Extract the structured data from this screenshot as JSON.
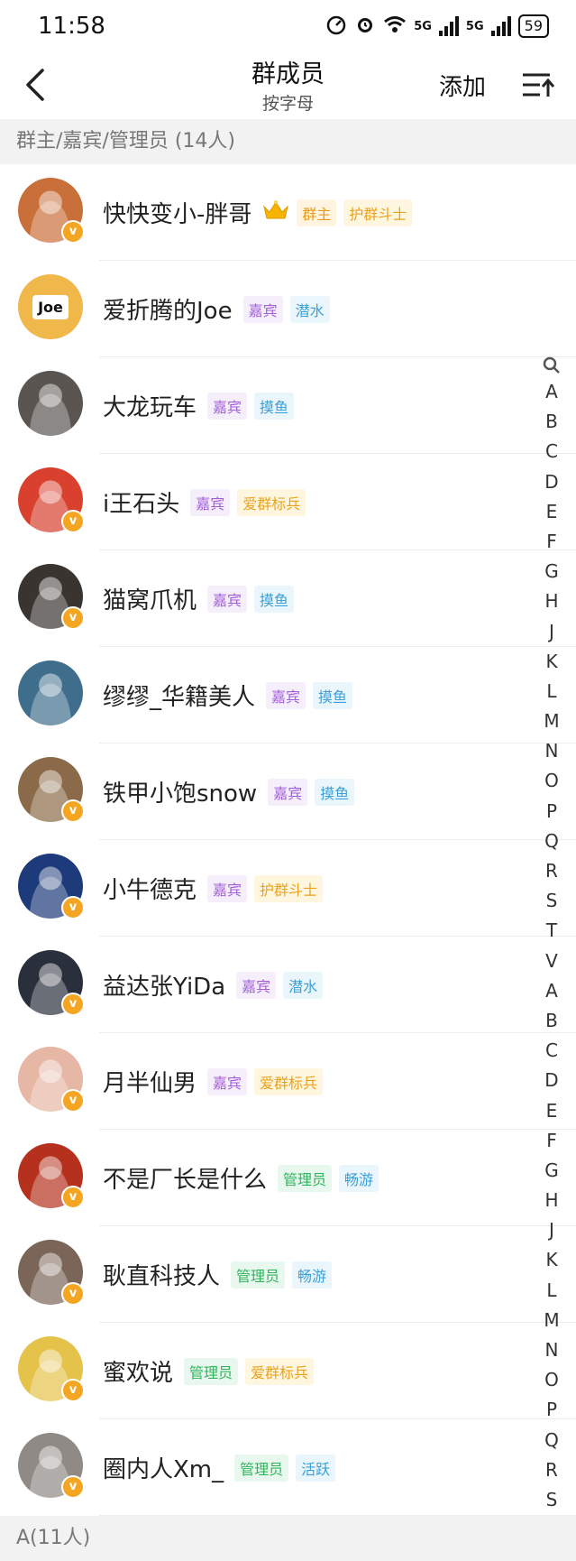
{
  "status_bar": {
    "time": "11:58",
    "battery": "59",
    "net1": "5G",
    "net2": "5G"
  },
  "header": {
    "title": "群成员",
    "subtitle": "按字母",
    "add_label": "添加"
  },
  "sections": {
    "managers": "群主/嘉宾/管理员 (14人)",
    "a_section": "A(11人)"
  },
  "members": [
    {
      "name": "快快变小-胖哥",
      "crown": true,
      "verified": true,
      "avatar_color": "#c96f3a",
      "avatar_text": "",
      "tags": [
        {
          "label": "群主",
          "type": "owner"
        },
        {
          "label": "护群斗士",
          "type": "fighter"
        }
      ]
    },
    {
      "name": "爱折腾的Joe",
      "verified": false,
      "avatar_color": "#f0b74a",
      "avatar_text": "Joe",
      "tags": [
        {
          "label": "嘉宾",
          "type": "guest"
        },
        {
          "label": "潜水",
          "type": "dive"
        }
      ]
    },
    {
      "name": "大龙玩车",
      "verified": false,
      "avatar_color": "#5a5550",
      "avatar_text": "",
      "tags": [
        {
          "label": "嘉宾",
          "type": "guest"
        },
        {
          "label": "摸鱼",
          "type": "fish"
        }
      ]
    },
    {
      "name": "i王石头",
      "verified": true,
      "avatar_color": "#d9402e",
      "avatar_text": "",
      "tags": [
        {
          "label": "嘉宾",
          "type": "guest"
        },
        {
          "label": "爱群标兵",
          "type": "soldier"
        }
      ]
    },
    {
      "name": "猫窝爪机",
      "verified": true,
      "avatar_color": "#3a3430",
      "avatar_text": "",
      "tags": [
        {
          "label": "嘉宾",
          "type": "guest"
        },
        {
          "label": "摸鱼",
          "type": "fish"
        }
      ]
    },
    {
      "name": "缪缪_华籍美人",
      "verified": false,
      "avatar_color": "#3f6e8c",
      "avatar_text": "",
      "tags": [
        {
          "label": "嘉宾",
          "type": "guest"
        },
        {
          "label": "摸鱼",
          "type": "fish"
        }
      ]
    },
    {
      "name": "铁甲小饱snow",
      "verified": true,
      "avatar_color": "#8a6a48",
      "avatar_text": "",
      "tags": [
        {
          "label": "嘉宾",
          "type": "guest"
        },
        {
          "label": "摸鱼",
          "type": "fish"
        }
      ]
    },
    {
      "name": "小牛德克",
      "verified": true,
      "avatar_color": "#1d3a7a",
      "avatar_text": "",
      "tags": [
        {
          "label": "嘉宾",
          "type": "guest"
        },
        {
          "label": "护群斗士",
          "type": "fighter"
        }
      ]
    },
    {
      "name": "益达张YiDa",
      "verified": true,
      "avatar_color": "#2a2f3c",
      "avatar_text": "",
      "tags": [
        {
          "label": "嘉宾",
          "type": "guest"
        },
        {
          "label": "潜水",
          "type": "dive"
        }
      ]
    },
    {
      "name": "月半仙男",
      "verified": true,
      "avatar_color": "#e6b7a5",
      "avatar_text": "",
      "tags": [
        {
          "label": "嘉宾",
          "type": "guest"
        },
        {
          "label": "爱群标兵",
          "type": "soldier"
        }
      ]
    },
    {
      "name": "不是厂长是什么",
      "verified": true,
      "avatar_color": "#b5311e",
      "avatar_text": "",
      "tags": [
        {
          "label": "管理员",
          "type": "admin"
        },
        {
          "label": "畅游",
          "type": "roam"
        }
      ]
    },
    {
      "name": "耿直科技人",
      "verified": true,
      "avatar_color": "#7a6558",
      "avatar_text": "",
      "tags": [
        {
          "label": "管理员",
          "type": "admin"
        },
        {
          "label": "畅游",
          "type": "roam"
        }
      ]
    },
    {
      "name": "蜜欢说",
      "verified": true,
      "avatar_color": "#e5c24a",
      "avatar_text": "",
      "tags": [
        {
          "label": "管理员",
          "type": "admin"
        },
        {
          "label": "爱群标兵",
          "type": "soldier"
        }
      ]
    },
    {
      "name": "圈内人Xm_",
      "verified": true,
      "avatar_color": "#8f8a86",
      "avatar_text": "",
      "tags": [
        {
          "label": "管理员",
          "type": "admin"
        },
        {
          "label": "活跃",
          "type": "active"
        }
      ]
    }
  ],
  "verified_mark": "v",
  "index_letters": [
    "A",
    "B",
    "C",
    "D",
    "E",
    "F",
    "G",
    "H",
    "J",
    "K",
    "L",
    "M",
    "N",
    "O",
    "P",
    "Q",
    "R",
    "S",
    "T",
    "V",
    "A",
    "B",
    "C",
    "D",
    "E",
    "F",
    "G",
    "H",
    "J",
    "K",
    "L",
    "M",
    "N",
    "O",
    "P",
    "Q",
    "R",
    "S"
  ]
}
